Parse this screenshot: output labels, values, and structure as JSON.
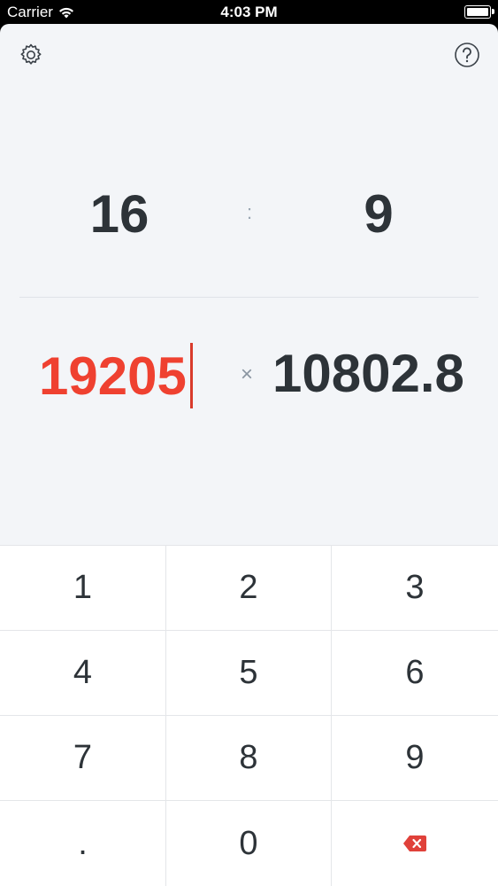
{
  "status_bar": {
    "carrier": "Carrier",
    "time": "4:03 PM"
  },
  "toolbar": {
    "settings_icon": "gear-icon",
    "help_icon": "question-circle-icon"
  },
  "ratio": {
    "width": "16",
    "separator": ":",
    "height": "9"
  },
  "resolution": {
    "width": "19205",
    "multiplier": "×",
    "height": "10802.8"
  },
  "keypad": {
    "keys": [
      "1",
      "2",
      "3",
      "4",
      "5",
      "6",
      "7",
      "8",
      "9",
      ".",
      "0"
    ],
    "backspace_icon": "backspace-icon",
    "backspace_color": "#e0413a"
  }
}
